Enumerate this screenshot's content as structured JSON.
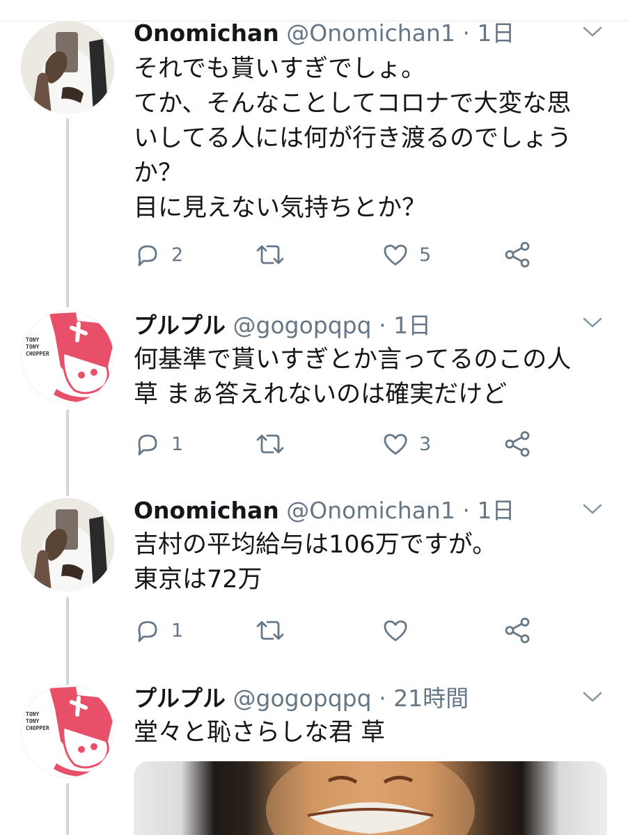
{
  "tweets": [
    {
      "name": "Onomichan",
      "handle": "@Onomichan1",
      "separator": "·",
      "time": "1日",
      "lines": [
        "それでも貰いすぎでしょ。",
        "てか、そんなことしてコロナで大変な思",
        "いしてる人には何が行き渡るのでしょう",
        "か？",
        "目に見えない気持ちとか？"
      ],
      "replies": "2",
      "retweets": "",
      "likes": "5"
    },
    {
      "name": "プルプル",
      "handle": "@gogopqpq",
      "separator": "·",
      "time": "1日",
      "lines": [
        "何基準で貰いすぎとか言ってるのこの人",
        "草 まぁ答えれないのは確実だけど"
      ],
      "replies": "1",
      "retweets": "",
      "likes": "3"
    },
    {
      "name": "Onomichan",
      "handle": "@Onomichan1",
      "separator": "·",
      "time": "1日",
      "lines": [
        "吉村の平均給与は106万ですが。",
        "東京は72万"
      ],
      "replies": "1",
      "retweets": "",
      "likes": ""
    },
    {
      "name": "プルプル",
      "handle": "@gogopqpq",
      "separator": "·",
      "time": "21時間",
      "lines": [
        "堂々と恥さらしな君 草"
      ]
    }
  ],
  "avatar_logo_text": "TONY TONY CHOPPER",
  "colors": {
    "text": "#14171a",
    "secondary": "#657786",
    "thread_line": "#ccd6dd",
    "chopper_pink": "#e8506a"
  },
  "icons": [
    "reply-icon",
    "retweet-icon",
    "like-icon",
    "share-icon",
    "chevron-down-icon"
  ]
}
